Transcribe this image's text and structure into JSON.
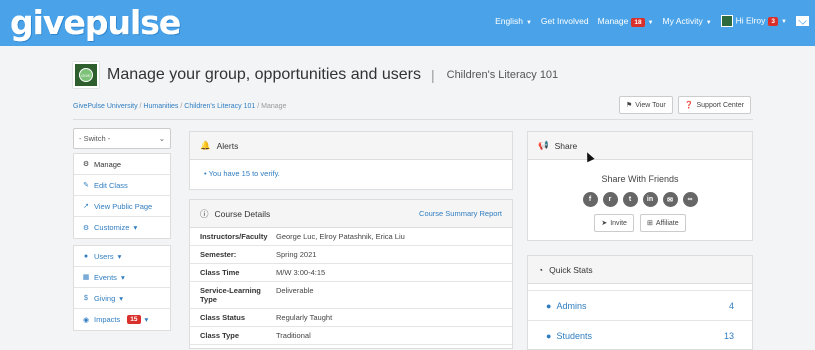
{
  "brand": {
    "logo_text": "givepulse"
  },
  "nav": {
    "language": "English",
    "get_involved": "Get Involved",
    "manage": "Manage",
    "manage_badge": "18",
    "my_activity": "My Activity",
    "user": "Hi Elroy",
    "user_badge": "3"
  },
  "header": {
    "title": "Manage your group, opportunities and users",
    "subtitle": "Children's Literacy 101",
    "group_logo_text": "GIVE"
  },
  "breadcrumb": {
    "items": [
      "GivePulse University",
      "Humanities",
      "Children's Literacy 101"
    ],
    "current": "Manage"
  },
  "top_buttons": {
    "view_tour": "View Tour",
    "support_center": "Support Center"
  },
  "sidebar": {
    "switch_label": "- Switch -",
    "group1": [
      "Manage",
      "Edit Class",
      "View Public Page",
      "Customize"
    ],
    "group2": [
      "Users",
      "Events",
      "Giving",
      "Impacts"
    ],
    "impacts_badge": "15"
  },
  "alerts": {
    "title": "Alerts",
    "item": "You have 15 to verify."
  },
  "course_details": {
    "title": "Course Details",
    "link": "Course Summary Report",
    "rows": [
      {
        "k": "Instructors/Faculty",
        "v": "George Luc, Elroy Patashnik, Erica Liu"
      },
      {
        "k": "Semester:",
        "v": "Spring 2021"
      },
      {
        "k": "Class Time",
        "v": "M/W 3:00-4:15"
      },
      {
        "k": "Service-Learning Type",
        "v": "Deliverable"
      },
      {
        "k": "Class Status",
        "v": "Regularly Taught"
      },
      {
        "k": "Class Type",
        "v": "Traditional"
      }
    ]
  },
  "share": {
    "title": "Share",
    "subtitle": "Share With Friends",
    "invite": "Invite",
    "affiliate": "Affiliate"
  },
  "quick_stats": {
    "title": "Quick Stats",
    "rows": [
      {
        "label": "Admins",
        "value": "4"
      },
      {
        "label": "Students",
        "value": "13"
      }
    ]
  }
}
